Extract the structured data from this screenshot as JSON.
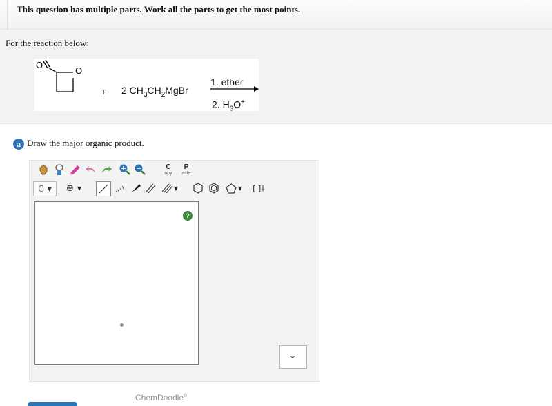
{
  "header": {
    "text": "This question has multiple parts. Work all the parts to get the most points."
  },
  "intro": {
    "text": "For the reaction below:"
  },
  "reaction": {
    "plus": "+",
    "reagent": "2 CH3CH2MgBr",
    "condition1": "1. ether",
    "condition2": "2. H3O+",
    "carbonyl_o": "O",
    "ring_o": "O"
  },
  "part_a": {
    "badge": "a",
    "prompt": "Draw the major organic product."
  },
  "editor": {
    "row1": [
      "hand-tool-icon",
      "lasso-icon",
      "eraser-icon",
      "undo-icon",
      "redo-icon",
      "zoom-in-icon",
      "zoom-out-icon",
      "copy-icon",
      "paste-icon"
    ],
    "copy_top": "C",
    "copy_bottom": "opy",
    "paste_top": "P",
    "paste_bottom": "aste",
    "element_button": "C",
    "charge_symbol": "⊕",
    "bracket_label": "[ ]‡",
    "watermark": "ChemDoodle",
    "watermark_reg": "®",
    "help": "?",
    "dropdown_value": "›"
  },
  "colors": {
    "accent": "#2d74b5",
    "help": "#3a8a3a"
  }
}
